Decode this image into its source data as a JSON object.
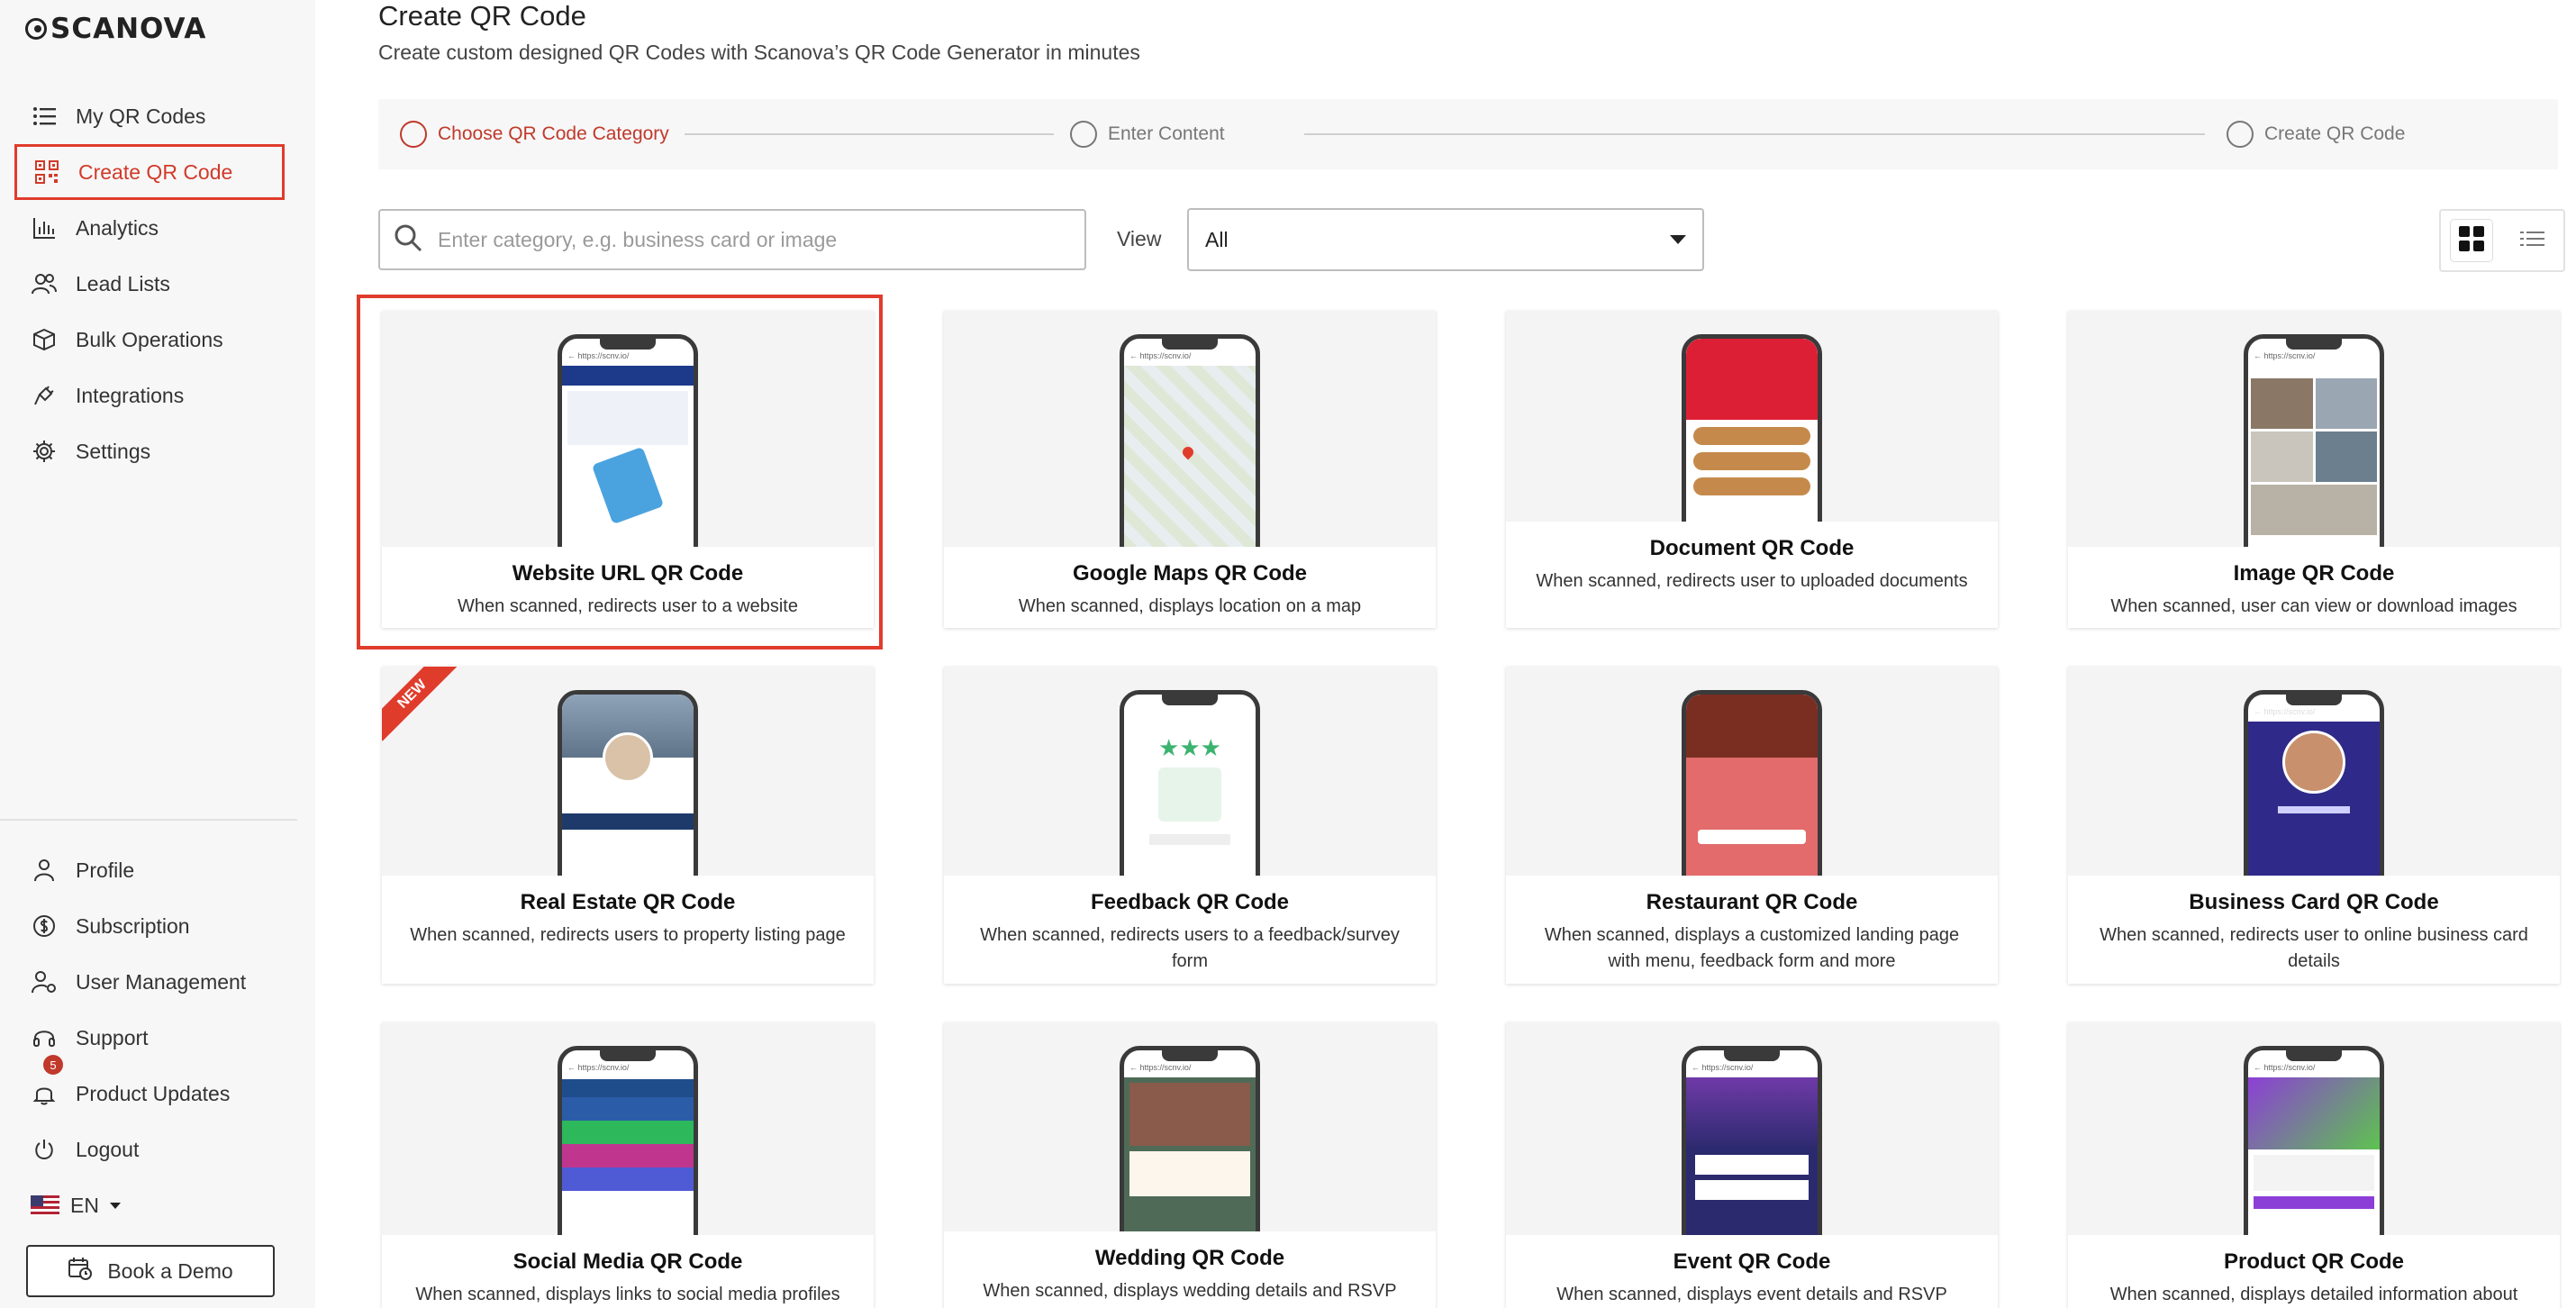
{
  "brand": {
    "logo_text": "SCANOVA",
    "accent": "#e03c2c"
  },
  "sidebar": {
    "top_items": [
      {
        "label": "My QR Codes",
        "icon": "list-icon",
        "active": false
      },
      {
        "label": "Create QR Code",
        "icon": "qr-code-icon",
        "active": true
      },
      {
        "label": "Analytics",
        "icon": "bar-chart-icon",
        "active": false
      },
      {
        "label": "Lead Lists",
        "icon": "users-icon",
        "active": false
      },
      {
        "label": "Bulk Operations",
        "icon": "cube-icon",
        "active": false
      },
      {
        "label": "Integrations",
        "icon": "plug-icon",
        "active": false
      },
      {
        "label": "Settings",
        "icon": "gear-icon",
        "active": false
      }
    ],
    "bottom_items": [
      {
        "label": "Profile",
        "icon": "user-icon"
      },
      {
        "label": "Subscription",
        "icon": "dollar-icon"
      },
      {
        "label": "User Management",
        "icon": "user-gear-icon"
      },
      {
        "label": "Support",
        "icon": "headset-icon"
      },
      {
        "label": "Product Updates",
        "icon": "bell-icon",
        "badge": "5"
      },
      {
        "label": "Logout",
        "icon": "power-icon"
      }
    ],
    "language": "EN",
    "demo_button": "Book a Demo"
  },
  "header": {
    "title": "Create QR Code",
    "subtitle": "Create custom designed QR Codes with Scanova’s QR Code Generator in minutes"
  },
  "stepper": {
    "steps": [
      "Choose QR Code Category",
      "Enter Content",
      "Create QR Code"
    ],
    "current": 0
  },
  "filters": {
    "search_placeholder": "Enter category, e.g. business card or image",
    "view_label": "View",
    "view_value": "All"
  },
  "cards": [
    {
      "title": "Website URL QR Code",
      "desc": "When scanned, redirects user to a website",
      "selected": true
    },
    {
      "title": "Google Maps QR Code",
      "desc": "When scanned, displays location on a map"
    },
    {
      "title": "Document QR Code",
      "desc": "When scanned, redirects user to uploaded documents"
    },
    {
      "title": "Image QR Code",
      "desc": "When scanned, user can view or download images"
    },
    {
      "title": "Real Estate QR Code",
      "desc": "When scanned, redirects users to property listing page",
      "ribbon": "NEW"
    },
    {
      "title": "Feedback QR Code",
      "desc": "When scanned, redirects users to a feedback/survey form"
    },
    {
      "title": "Restaurant QR Code",
      "desc": "When scanned, displays a customized landing page with menu, feedback form and more"
    },
    {
      "title": "Business Card QR Code",
      "desc": "When scanned, redirects user to online business card details"
    },
    {
      "title": "Social Media QR Code",
      "desc": "When scanned, displays links to social media profiles"
    },
    {
      "title": "Wedding QR Code",
      "desc": "When scanned, displays wedding details and RSVP option"
    },
    {
      "title": "Event QR Code",
      "desc": "When scanned, displays event details and RSVP"
    },
    {
      "title": "Product QR Code",
      "desc": "When scanned, displays detailed information about"
    }
  ]
}
